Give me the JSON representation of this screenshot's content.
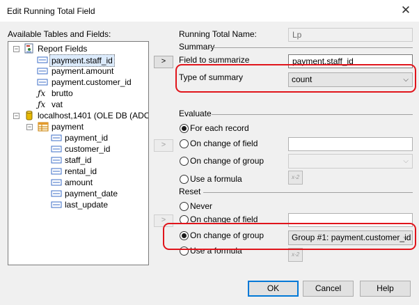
{
  "window": {
    "title": "Edit Running Total Field",
    "close_glyph": "✕"
  },
  "tree_panel": {
    "label": "Available Tables and Fields:",
    "report_fields": {
      "label": "Report Fields",
      "items": [
        "payment.staff_id",
        "payment.amount",
        "payment.customer_id",
        "brutto",
        "vat"
      ]
    },
    "connection": {
      "label": "localhost,1401 (OLE DB (ADO))",
      "table": {
        "label": "payment",
        "columns": [
          "payment_id",
          "customer_id",
          "staff_id",
          "rental_id",
          "amount",
          "payment_date",
          "last_update"
        ]
      }
    },
    "selected": "payment.staff_id"
  },
  "arrow_buttons": {
    "glyph": ">"
  },
  "formula_button": {
    "glyph": "x-2"
  },
  "running_total": {
    "name_label": "Running Total Name:",
    "name_value": "Lp",
    "summary_header": "Summary",
    "field_label": "Field to summarize",
    "field_value": "payment.staff_id",
    "type_label": "Type of summary",
    "type_value": "count"
  },
  "evaluate": {
    "header": "Evaluate",
    "options": [
      "For each record",
      "On change of field",
      "On change of group",
      "Use a formula"
    ],
    "selected": "For each record",
    "field_value": "",
    "group_value": ""
  },
  "reset": {
    "header": "Reset",
    "options": [
      "Never",
      "On change of field",
      "On change of group",
      "Use a formula"
    ],
    "selected": "On change of group",
    "field_value": "",
    "group_value": "Group #1: payment.customer_id"
  },
  "buttons": {
    "ok": "OK",
    "cancel": "Cancel",
    "help": "Help"
  },
  "colors": {
    "highlight": "#e0141b",
    "default_button_border": "#0078d7",
    "selection": "#dcebfc"
  }
}
